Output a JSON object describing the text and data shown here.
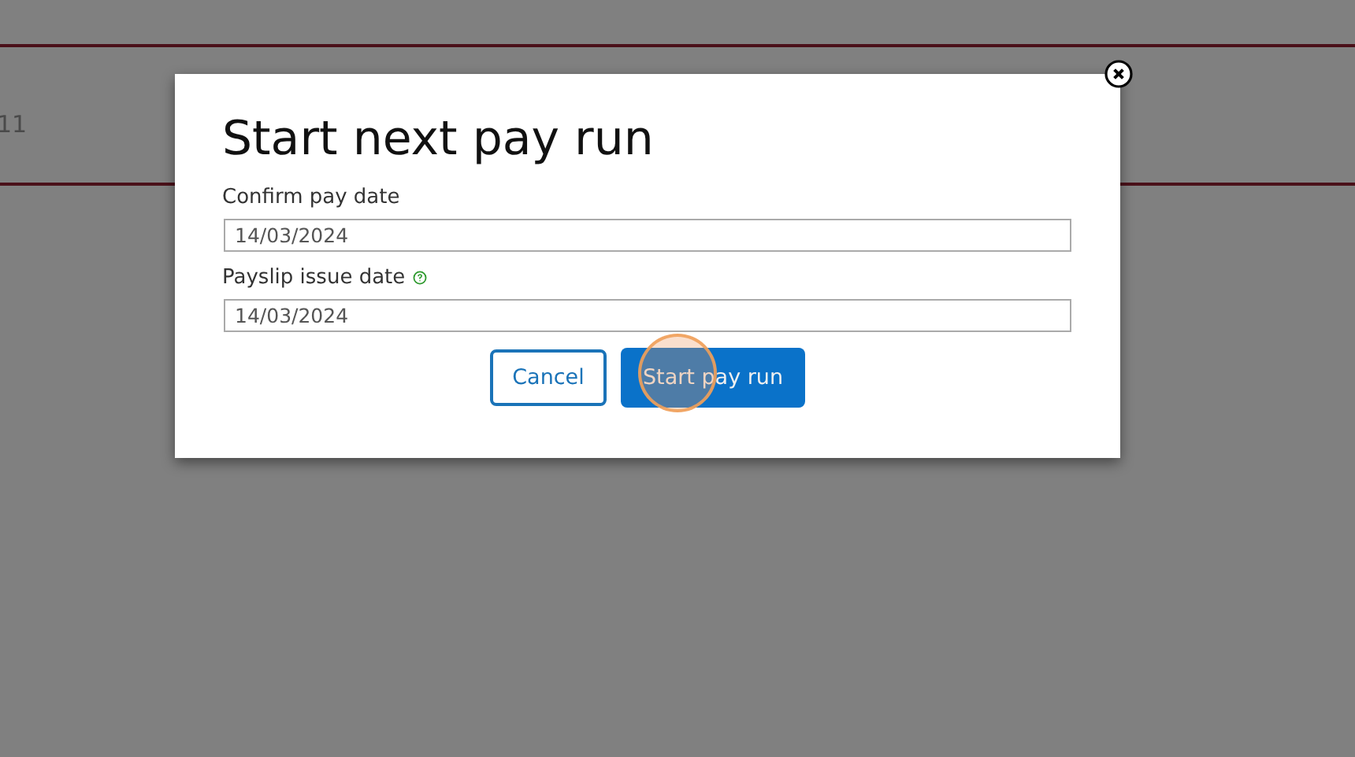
{
  "background": {
    "row_fragment": "11"
  },
  "dialog": {
    "title": "Start next pay run",
    "fields": [
      {
        "label": "Confirm pay date",
        "value": "14/03/2024",
        "help": false
      },
      {
        "label": "Payslip issue date",
        "value": "14/03/2024",
        "help": true
      }
    ],
    "buttons": [
      {
        "label": "Cancel",
        "kind": "secondary"
      },
      {
        "label": "Start pay run",
        "kind": "primary"
      }
    ]
  }
}
